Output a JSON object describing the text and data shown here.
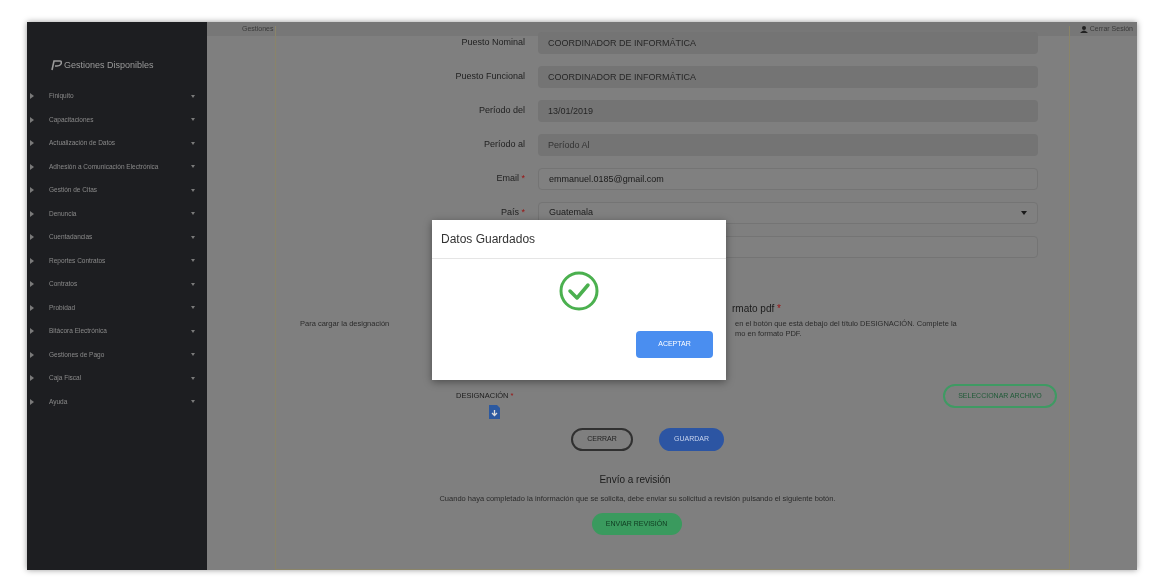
{
  "sidebar": {
    "title": "Gestiones Disponibles",
    "items": [
      {
        "label": "Finiquito"
      },
      {
        "label": "Capacitaciones"
      },
      {
        "label": "Actualización de Datos"
      },
      {
        "label": "Adhesión a Comunicación Electrónica"
      },
      {
        "label": "Gestión de Citas"
      },
      {
        "label": "Denuncia"
      },
      {
        "label": "Cuentadancias"
      },
      {
        "label": "Reportes Contratos"
      },
      {
        "label": "Contratos"
      },
      {
        "label": "Probidad"
      },
      {
        "label": "Bitácora Electrónica"
      },
      {
        "label": "Gestiones de Pago"
      },
      {
        "label": "Caja Fiscal"
      },
      {
        "label": "Ayuda"
      }
    ]
  },
  "topbar": {
    "breadcrumb": "Gestiones",
    "logout": "Cerrar Sesión"
  },
  "form": {
    "fields": [
      {
        "label": "Puesto Nominal",
        "kind": "text",
        "value": "COORDINADOR DE INFORMÁTICA",
        "disabled": true
      },
      {
        "label": "Puesto Funcional",
        "kind": "text",
        "value": "COORDINADOR DE INFORMÁTICA",
        "disabled": true
      },
      {
        "label": "Período del",
        "kind": "text",
        "value": "13/01/2019",
        "disabled": true
      },
      {
        "label": "Período al",
        "kind": "text",
        "placeholder": "Período Al",
        "disabled": true
      },
      {
        "label": "Email",
        "required_mark": "*",
        "kind": "text",
        "value": "emmanuel.0185@gmail.com",
        "disabled": false
      },
      {
        "label": "País",
        "required_mark": "*",
        "kind": "select",
        "value": "Guatemala",
        "disabled": false
      },
      {
        "kind": "text",
        "disabled": false
      }
    ]
  },
  "upload": {
    "heading": "rmato pdf",
    "required_mark": "*",
    "text_left": "Para cargar la designación",
    "text_right": "en el botón que está debajo del título DESIGNACIÓN. Complete la",
    "text_right_2": "mo en formato PDF.",
    "file_label": "DESIGNACIÓN",
    "file_required_mark": "*",
    "select_button": "SELECCIONAR ARCHIVO"
  },
  "actions": [
    "CERRAR",
    "GUARDAR"
  ],
  "review": {
    "heading": "Envío a revisión",
    "text": "Cuando haya completado la información que se solicita, debe enviar su solicitud a revisión pulsando el siguiente botón.",
    "button": "ENVIAR REVISIÓN"
  },
  "dialog": {
    "title": "Datos Guardados",
    "button": "ACEPTAR"
  }
}
